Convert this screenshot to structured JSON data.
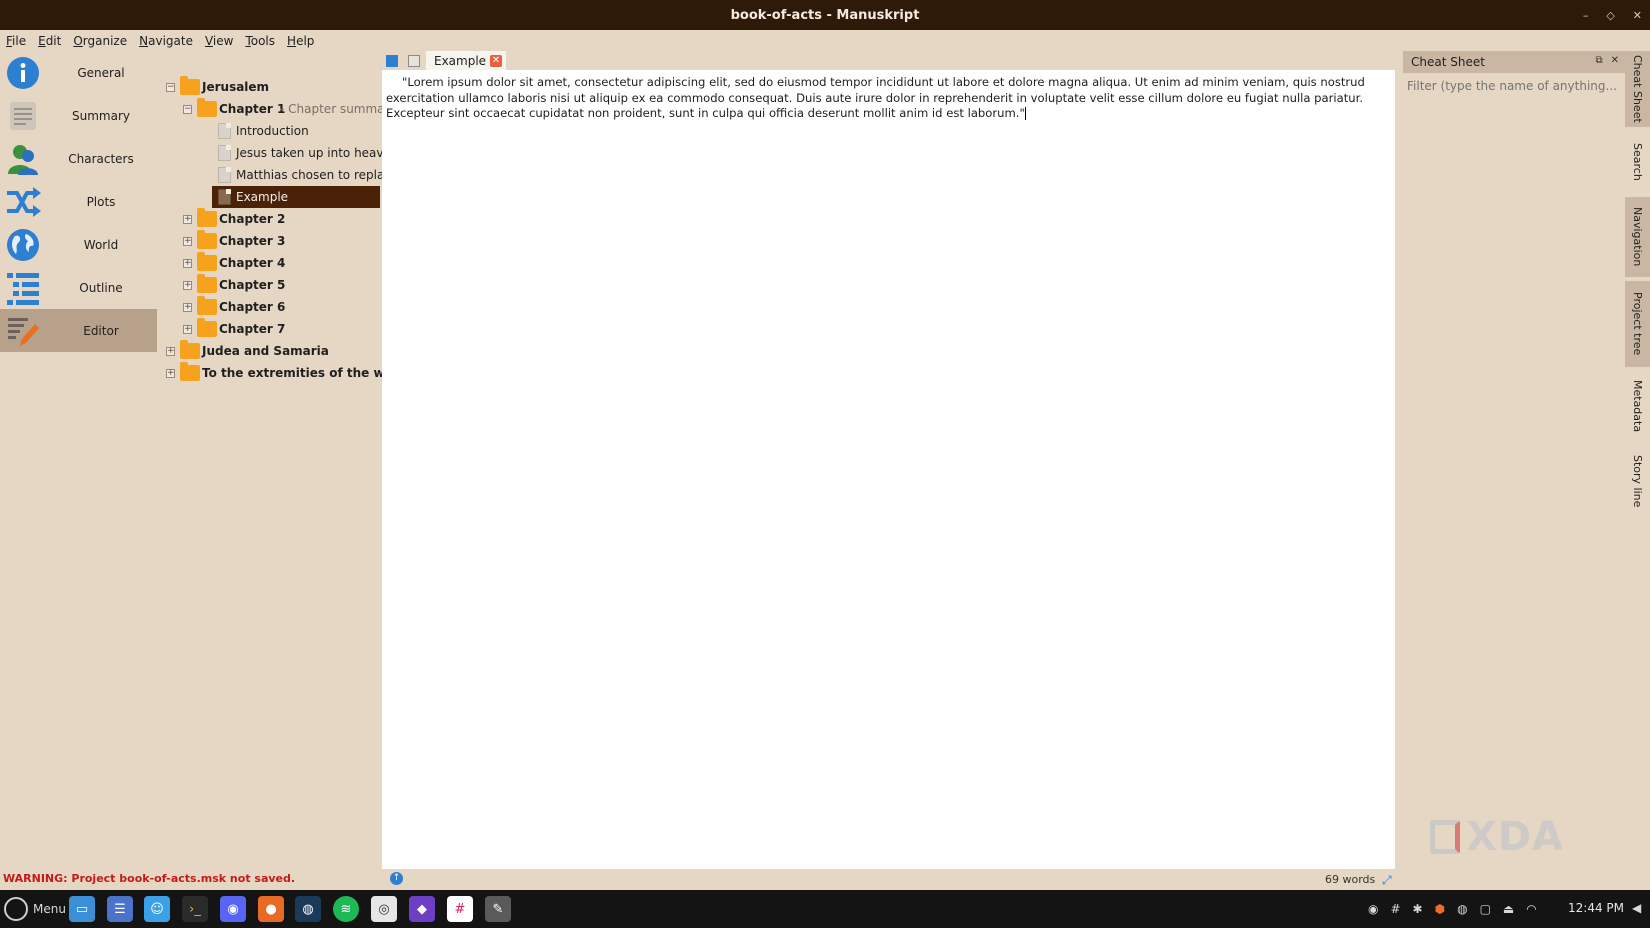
{
  "window": {
    "title": "book-of-acts - Manuskript",
    "controls": [
      "–",
      "◇",
      "✕"
    ]
  },
  "menu": [
    "File",
    "Edit",
    "Organize",
    "Navigate",
    "View",
    "Tools",
    "Help"
  ],
  "nav": [
    {
      "label": "General",
      "icon": "info-icon"
    },
    {
      "label": "Summary",
      "icon": "summary-icon"
    },
    {
      "label": "Characters",
      "icon": "characters-icon"
    },
    {
      "label": "Plots",
      "icon": "plots-icon"
    },
    {
      "label": "World",
      "icon": "world-icon"
    },
    {
      "label": "Outline",
      "icon": "outline-icon"
    },
    {
      "label": "Editor",
      "icon": "editor-icon",
      "active": true
    }
  ],
  "tree": {
    "jerusalem": "Jerusalem",
    "chapter1": "Chapter 1",
    "chapter1_summary": "- Chapter summary",
    "introduction": "Introduction",
    "jesus": "Jesus taken up into heaven",
    "matthias": "Matthias chosen to repla...",
    "example": "Example",
    "chapter2": "Chapter 2",
    "chapter3": "Chapter 3",
    "chapter4": "Chapter 4",
    "chapter5": "Chapter 5",
    "chapter6": "Chapter 6",
    "chapter7": "Chapter 7",
    "judea": "Judea and Samaria",
    "extremities": "To the extremities of the world"
  },
  "editor": {
    "tab_label": "Example",
    "text": "\"Lorem ipsum dolor sit amet, consectetur adipiscing elit, sed do eiusmod tempor incididunt ut labore et dolore magna aliqua. Ut enim ad minim veniam, quis nostrud exercitation ullamco laboris nisi ut aliquip ex ea commodo consequat. Duis aute irure dolor in reprehenderit in voluptate velit esse cillum dolore eu fugiat nulla pariatur. Excepteur sint occaecat cupidatat non proident, sunt in culpa qui officia deserunt mollit anim id est laborum.\""
  },
  "dock": {
    "title": "Cheat Sheet",
    "filter_placeholder": "Filter (type the name of anything...",
    "tabs": [
      "Cheat Sheet",
      "Search",
      "Navigation",
      "Project tree",
      "Metadata",
      "Story line"
    ]
  },
  "status": {
    "warning": "WARNING: Project book-of-acts.msk not saved.",
    "word_count": "69 words"
  },
  "watermark": "XDA",
  "taskbar": {
    "menu_label": "Menu",
    "clock": "12:44 PM",
    "apps": [
      "files-icon",
      "settings-icon",
      "finder-icon",
      "terminal-icon",
      "discord-icon",
      "firefox-icon",
      "steam-icon",
      "spotify-icon",
      "screenshot-icon",
      "obsidian-icon",
      "slack-icon",
      "manuskript-icon"
    ]
  },
  "colors": {
    "accent": "#4a2207",
    "titlebar": "#2e1a09",
    "folder": "#f6a21d",
    "warning": "#c41a1a",
    "blue": "#2d7fd1"
  }
}
